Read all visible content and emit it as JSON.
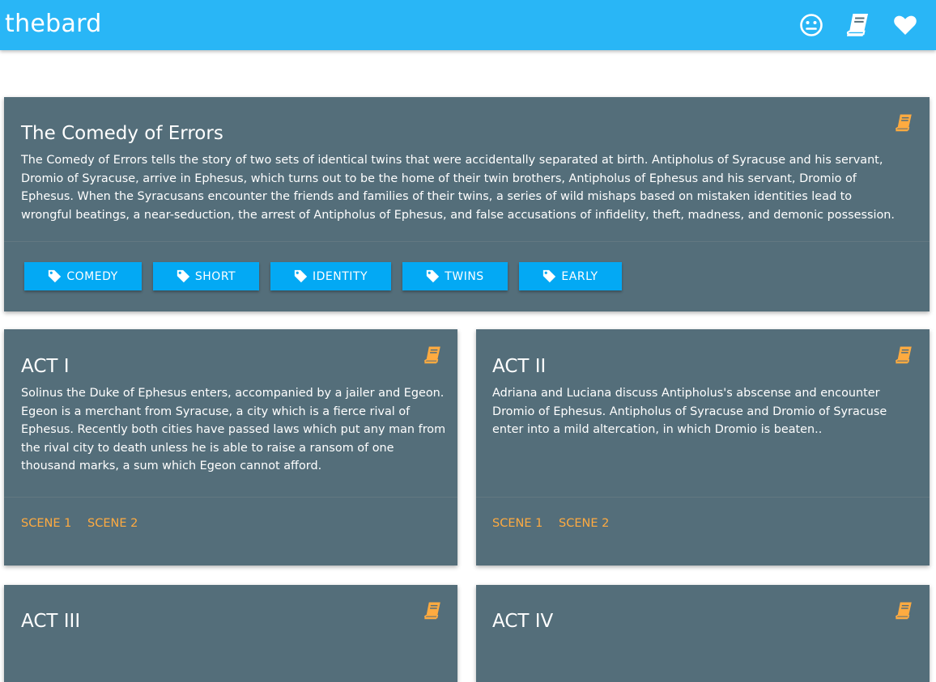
{
  "app": {
    "brand": "thebard",
    "colors": {
      "topbar": "#29b6f6",
      "card": "#546e7a",
      "tag": "#03a9f4",
      "accent": "#ffab40"
    },
    "nav_icons": [
      "neutral-face-icon",
      "book-icon",
      "heart-icon"
    ]
  },
  "play": {
    "title": "The Comedy of Errors",
    "description": "The Comedy of Errors tells the story of two sets of identical twins that were accidentally separated at birth. Antipholus of Syracuse and his servant, Dromio of Syracuse, arrive in Ephesus, which turns out to be the home of their twin brothers, Antipholus of Ephesus and his servant, Dromio of Ephesus. When the Syracusans encounter the friends and families of their twins, a series of wild mishaps based on mistaken identities lead to wrongful beatings, a near-seduction, the arrest of Antipholus of Ephesus, and false accusations of infidelity, theft, madness, and demonic possession.",
    "tags": [
      "COMEDY",
      "SHORT",
      "IDENTITY",
      "TWINS",
      "EARLY"
    ]
  },
  "acts": [
    {
      "title": "ACT I",
      "summary": "Solinus the Duke of Ephesus enters, accompanied by a jailer and Egeon. Egeon is a merchant from Syracuse, a city which is a fierce rival of Ephesus. Recently both cities have passed laws which put any man from the rival city to death unless he is able to raise a ransom of one thousand marks, a sum which Egeon cannot afford.",
      "scenes": [
        "SCENE 1",
        "SCENE 2"
      ]
    },
    {
      "title": "ACT II",
      "summary": "Adriana and Luciana discuss Antipholus's abscense and encounter Dromio of Ephesus. Antipholus of Syracuse and Dromio of Syracuse enter into a mild altercation, in which Dromio is beaten..",
      "scenes": [
        "SCENE 1",
        "SCENE 2"
      ]
    },
    {
      "title": "ACT III"
    },
    {
      "title": "ACT IV"
    }
  ]
}
